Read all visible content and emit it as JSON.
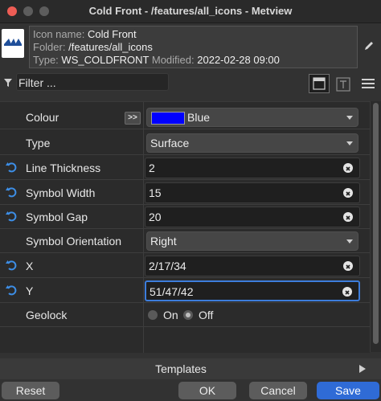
{
  "window": {
    "title": "Cold Front - /features/all_icons - Metview"
  },
  "info": {
    "name_label": "Icon name:",
    "name_value": "Cold Front",
    "folder_label": "Folder:",
    "folder_value": "/features/all_icons",
    "type_label": "Type:",
    "type_value": "WS_COLDFRONT",
    "modified_label": "Modified:",
    "modified_value": "2022-02-28 09:00"
  },
  "filter": {
    "placeholder": "Filter ..."
  },
  "params": {
    "colour": {
      "label": "Colour",
      "value": "Blue",
      "swatch": "#0000ff",
      "button": ">>"
    },
    "type": {
      "label": "Type",
      "value": "Surface"
    },
    "line_thickness": {
      "label": "Line Thickness",
      "value": "2"
    },
    "symbol_width": {
      "label": "Symbol Width",
      "value": "15"
    },
    "symbol_gap": {
      "label": "Symbol Gap",
      "value": "20"
    },
    "symbol_orientation": {
      "label": "Symbol Orientation",
      "value": "Right"
    },
    "x": {
      "label": "X",
      "value": "2/17/34"
    },
    "y": {
      "label": "Y",
      "value": "51/47/42"
    },
    "geolock": {
      "label": "Geolock",
      "on_label": "On",
      "off_label": "Off",
      "selected": "Off"
    }
  },
  "templates": {
    "label": "Templates"
  },
  "buttons": {
    "reset": "Reset",
    "ok": "OK",
    "cancel": "Cancel",
    "save": "Save"
  },
  "colors": {
    "accent": "#2f6bd6",
    "reset_icon": "#3d8ee6",
    "close": "#ee5d55"
  }
}
